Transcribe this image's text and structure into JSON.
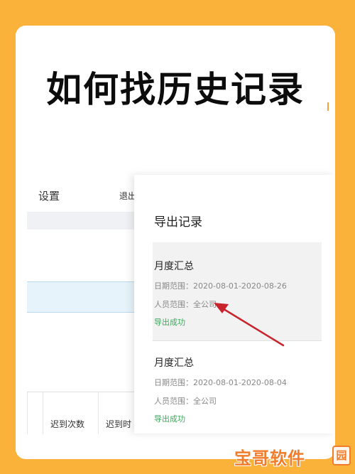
{
  "headline": "如何找历史记录",
  "background_app": {
    "settings_label": "设置",
    "logout_label": "退出",
    "table_columns": [
      "",
      "迟到次数",
      "迟到时"
    ]
  },
  "drawer": {
    "title": "导出记录",
    "records": [
      {
        "title": "月度汇总",
        "date_range": "日期范围：2020-08-01-2020-08-26",
        "people_range": "人员范围：全公司",
        "status": "导出成功",
        "selected": true
      },
      {
        "title": "月度汇总",
        "date_range": "日期范围：2020-08-01-2020-08-04",
        "people_range": "人员范围：全公司",
        "status": "导出成功",
        "selected": false
      }
    ]
  },
  "watermark": {
    "text": "宝哥软件",
    "badge": "园"
  },
  "colors": {
    "page_background": "#fbb23b",
    "status_green": "#3aaa5c",
    "arrow_red": "#c8232c",
    "watermark_orange": "#f07c2c"
  }
}
